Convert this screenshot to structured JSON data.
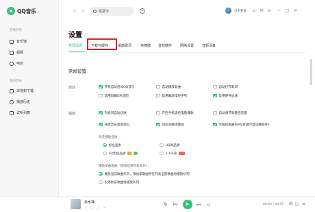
{
  "app": {
    "logo_text": "QQ音乐"
  },
  "sidebar": {
    "section_online": "在线音乐",
    "online_items": [
      {
        "label": "音乐馆",
        "icon": "music-hall-icon"
      },
      {
        "label": "视频",
        "icon": "video-icon"
      },
      {
        "label": "电台",
        "icon": "radio-icon"
      }
    ],
    "section_mine": "我的音乐",
    "mine_items": [
      {
        "label": "本地和下载",
        "icon": "download-icon"
      },
      {
        "label": "播放历史",
        "icon": "history-icon"
      },
      {
        "label": "试听列表",
        "icon": "playlist-icon"
      }
    ]
  },
  "topbar": {
    "back": "‹",
    "forward": "›",
    "search_text": "陈慧今",
    "login_label": "点击登录",
    "icons": [
      "shirt-icon",
      "mail-icon",
      "menu-icon"
    ],
    "window_controls": [
      "minimize-icon",
      "maximize-icon",
      "close-icon"
    ]
  },
  "page": {
    "title": "设置",
    "tabs": [
      "常规设置",
      "下载与缓存",
      "桌面歌词",
      "快捷键",
      "音效插件",
      "网络设置",
      "音频设备"
    ],
    "active_tab": "常规设置",
    "highlighted_tab": "下载与缓存",
    "section_title": "常规设置",
    "launch": {
      "label": "启动",
      "options": [
        {
          "text": "开机自动启动QQ音乐",
          "checked": true
        },
        {
          "text": "自动播放歌曲",
          "checked": false
        },
        {
          "text": "自动打开歌词",
          "checked": false
        },
        {
          "text": "禁用屏幕DPI适配",
          "checked": false
        },
        {
          "text": "禁用触屏操控手势",
          "checked": false
        },
        {
          "text": "禁用硬件加速",
          "checked": true
        }
      ]
    },
    "playback": {
      "label": "播放",
      "options": [
        {
          "text": "列表间自动切换",
          "checked": true
        },
        {
          "text": "开启手机遥控电脑播歌",
          "checked": false
        },
        {
          "text": "自动调节到最佳音量",
          "checked": false
        },
        {
          "text": "开启音乐渐进渐出",
          "checked": true
        },
        {
          "text": "响应多媒体键盘",
          "checked": true
        },
        {
          "text": "无版权歌曲有MV资源时自动播放MV",
          "checked": true
        }
      ],
      "quality_label": "优先播放品质：",
      "quality_options": [
        {
          "text": "标准品质",
          "selected": true,
          "badge": ""
        },
        {
          "text": "HQ高品质",
          "selected": false,
          "badge": ""
        },
        {
          "text": "SQ无损品质",
          "selected": false,
          "badge": "vip"
        },
        {
          "text": "5.1声道",
          "selected": false,
          "badge": "red"
        }
      ],
      "double_click_label": "播放单曲歌曲（搜索结果列表除外）：",
      "double_click_options": [
        {
          "text": "播放当前歌曲队列，添加该歌曲所在列表全部歌曲进播放队列",
          "selected": true
        },
        {
          "text": "仅添加该歌曲进播放队列",
          "selected": false
        }
      ]
    }
  },
  "player": {
    "song": "云水禅",
    "time": "00:00 / 04:01",
    "song_icons": [
      "heart-icon",
      "download-icon",
      "comment-icon",
      "more-icon"
    ],
    "controls": [
      "loop-icon",
      "prev-icon",
      "play-icon",
      "next-icon",
      "volume-icon"
    ],
    "right_icons": [
      "lyrics-icon",
      "quality-icon",
      "playlist-icon"
    ]
  },
  "colors": {
    "accent": "#31c27c",
    "highlight_box": "#e0202a"
  }
}
